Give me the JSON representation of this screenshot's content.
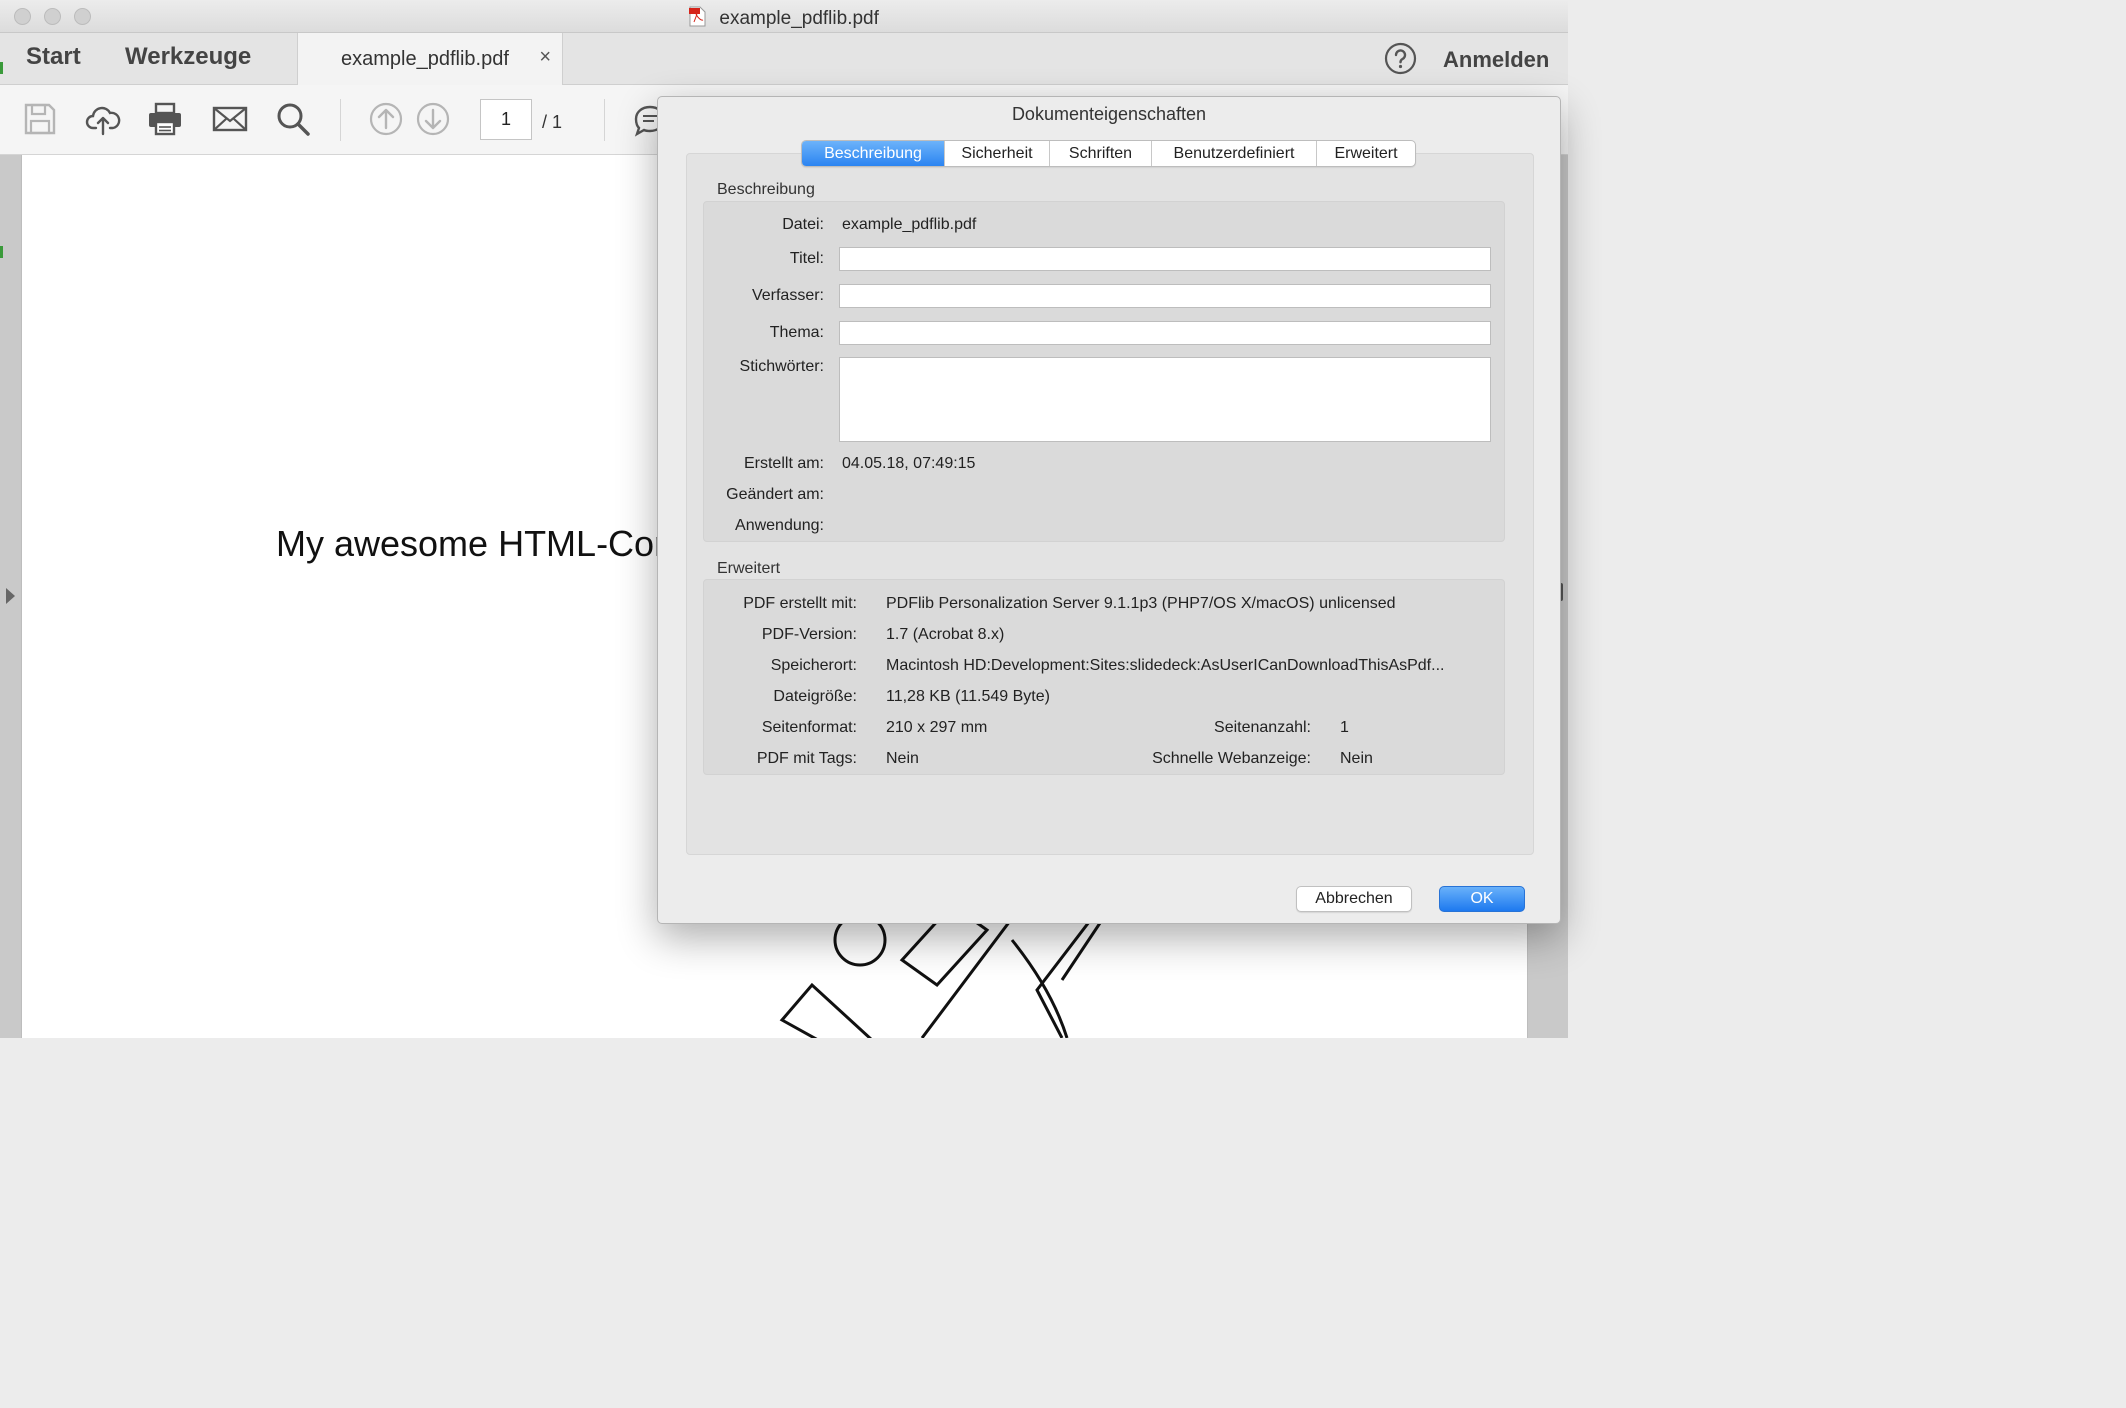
{
  "window": {
    "title": "example_pdflib.pdf"
  },
  "nav": {
    "start": "Start",
    "tools": "Werkzeuge",
    "doc_tab": "example_pdflib.pdf",
    "doc_tab_close": "×",
    "sign_in": "Anmelden"
  },
  "toolbar": {
    "icons": [
      "save-icon",
      "upload-cloud-icon",
      "print-icon",
      "mail-icon",
      "search-icon",
      "page-up-icon",
      "page-down-icon",
      "comment-icon"
    ],
    "page_current": "1",
    "page_total": "/ 1"
  },
  "document": {
    "visible_text": "My awesome HTML-Cor"
  },
  "dialog": {
    "title": "Dokumenteigenschaften",
    "tabs": [
      "Beschreibung",
      "Sicherheit",
      "Schriften",
      "Benutzerdefiniert",
      "Erweitert"
    ],
    "active_tab": "Beschreibung",
    "description": {
      "section_label": "Beschreibung",
      "file_label": "Datei:",
      "file_value": "example_pdflib.pdf",
      "title_label": "Titel:",
      "title_value": "",
      "author_label": "Verfasser:",
      "author_value": "",
      "subject_label": "Thema:",
      "subject_value": "",
      "keywords_label": "Stichwörter:",
      "keywords_value": "",
      "created_label": "Erstellt am:",
      "created_value": "04.05.18, 07:49:15",
      "modified_label": "Geändert am:",
      "modified_value": "",
      "application_label": "Anwendung:",
      "application_value": ""
    },
    "advanced": {
      "section_label": "Erweitert",
      "producer_label": "PDF erstellt mit:",
      "producer_value": "PDFlib Personalization Server 9.1.1p3 (PHP7/OS X/macOS) unlicensed",
      "version_label": "PDF-Version:",
      "version_value": "1.7 (Acrobat 8.x)",
      "location_label": "Speicherort:",
      "location_value": "Macintosh HD:Development:Sites:slidedeck:AsUserICanDownloadThisAsPdf...",
      "size_label": "Dateigröße:",
      "size_value": "11,28 KB (11.549 Byte)",
      "format_label": "Seitenformat:",
      "format_value": "210 x 297 mm",
      "pages_label": "Seitenanzahl:",
      "pages_value": "1",
      "tagged_label": "PDF mit Tags:",
      "tagged_value": "Nein",
      "fastweb_label": "Schnelle Webanzeige:",
      "fastweb_value": "Nein"
    },
    "buttons": {
      "cancel": "Abbrechen",
      "ok": "OK"
    }
  },
  "colors": {
    "accent": "#2b84f1",
    "window_bg": "#ececec",
    "dialog_bg": "#ececec",
    "group_bg": "#dadada"
  }
}
